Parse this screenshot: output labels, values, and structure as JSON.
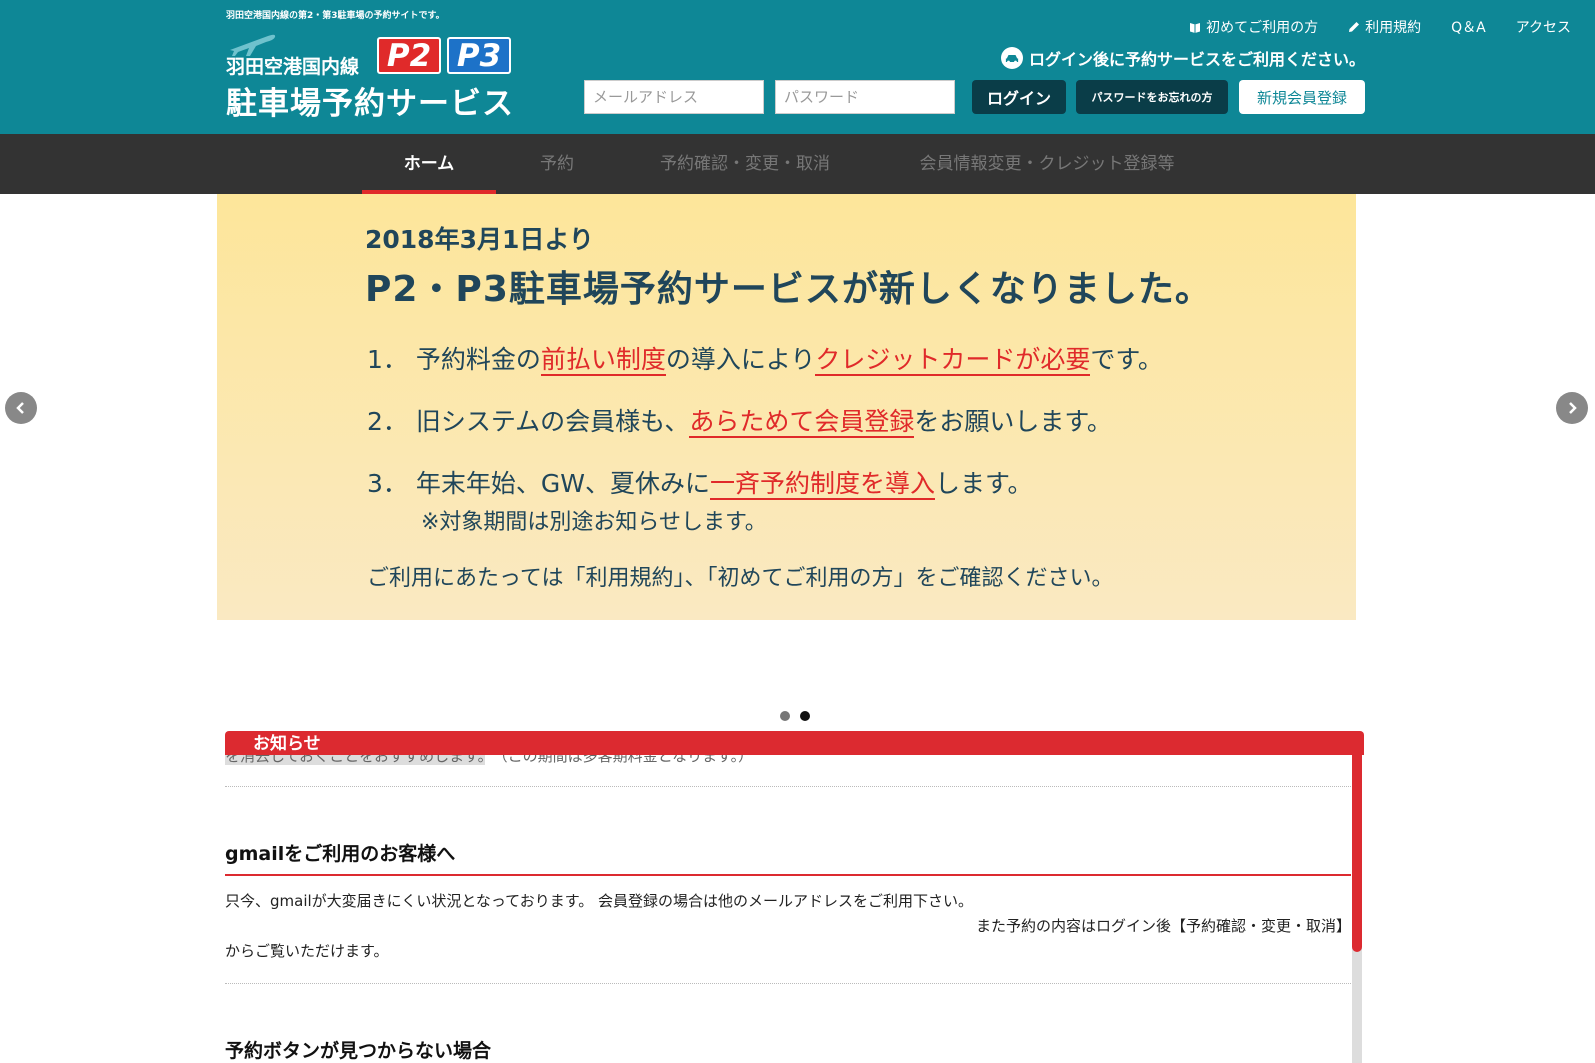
{
  "header": {
    "tagline": "羽田空港国内線の第2・第3駐車場の予約サイトです。",
    "logo_line1": "羽田空港国内線",
    "logo_line2": "駐車場予約サービス",
    "badge_p2": "P2",
    "badge_p3": "P3",
    "links": {
      "first_time": "初めてご利用の方",
      "terms": "利用規約",
      "qa": "Q＆A",
      "access": "アクセス"
    },
    "login_note": "ログイン後に予約サービスをご利用ください。",
    "email_placeholder": "メールアドレス",
    "password_placeholder": "パスワード",
    "login_button": "ログイン",
    "forgot_button": "パスワードをお忘れの方",
    "register_button": "新規会員登録"
  },
  "nav": {
    "home": "ホーム",
    "reserve": "予約",
    "manage": "予約確認・変更・取消",
    "member": "会員情報変更・クレジット登録等"
  },
  "banner": {
    "date": "2018年3月1日より",
    "headline": "P2・P3駐車場予約サービスが新しくなりました。",
    "p1_num": "1．",
    "p1_a": "予約料金の",
    "p1_red1": "前払い制度",
    "p1_b": "の導入により",
    "p1_red2": "クレジットカードが必要",
    "p1_c": "です。",
    "p2_num": "2．",
    "p2_a": "旧システムの会員様も、",
    "p2_red": "あらためて会員登録",
    "p2_b": "をお願いします。",
    "p3_num": "3．",
    "p3_a": "年末年始、GW、夏休みに",
    "p3_red": "一斉予約制度を導入",
    "p3_b": "します。",
    "note": "※対象期間は別途お知らせします。",
    "foot": "ご利用にあたっては「利用規約」、「初めてご利用の方」をご確認ください。"
  },
  "news": {
    "title": "お知らせ",
    "clipped_a": "を消去しておくことをおすすめします。",
    "clipped_b": "（この期間は多客期料金となります。）",
    "gmail_title": "gmailをご利用のお客様へ",
    "gmail_text1": "只今、gmailが大変届きにくい状況となっております。 会員登録の場合は他のメールアドレスをご利用下さい。",
    "gmail_text2": "また予約の内容はログイン後【予約確認・変更・取消】",
    "gmail_text3": "からご覧いただけます。",
    "next_title": "予約ボタンが見つからない場合"
  },
  "colors": {
    "header": "#0e8796",
    "nav": "#333333",
    "accent_red": "#dc2a30",
    "banner_top": "#fde69a",
    "banner_text": "#20465a"
  },
  "slider": {
    "total_slides": 2,
    "active_slide": 2
  }
}
